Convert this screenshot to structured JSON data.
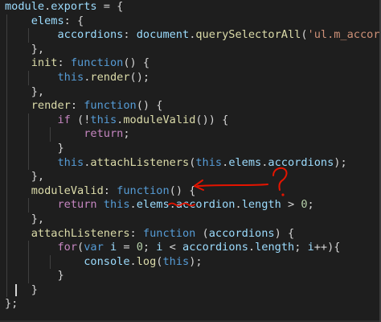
{
  "editor": {
    "annotation_color": "#e51400",
    "lines": [
      {
        "indent": 0,
        "tokens": [
          {
            "t": "module",
            "c": "var"
          },
          {
            "t": ".",
            "c": "pun"
          },
          {
            "t": "exports",
            "c": "var"
          },
          {
            "t": " = {",
            "c": "pun"
          }
        ]
      },
      {
        "indent": 1,
        "tokens": [
          {
            "t": "elems",
            "c": "var"
          },
          {
            "t": ": {",
            "c": "pun"
          }
        ]
      },
      {
        "indent": 2,
        "tokens": [
          {
            "t": "accordions",
            "c": "var"
          },
          {
            "t": ": ",
            "c": "pun"
          },
          {
            "t": "document",
            "c": "var"
          },
          {
            "t": ".",
            "c": "pun"
          },
          {
            "t": "querySelectorAll",
            "c": "fn"
          },
          {
            "t": "(",
            "c": "pun"
          },
          {
            "t": "'ul.m_accordion'",
            "c": "str"
          },
          {
            "t": ")",
            "c": "pun"
          }
        ]
      },
      {
        "indent": 1,
        "tokens": [
          {
            "t": "},",
            "c": "pun"
          }
        ]
      },
      {
        "indent": 1,
        "tokens": [
          {
            "t": "init",
            "c": "fn"
          },
          {
            "t": ": ",
            "c": "pun"
          },
          {
            "t": "function",
            "c": "kw"
          },
          {
            "t": "() {",
            "c": "pun"
          }
        ]
      },
      {
        "indent": 2,
        "tokens": [
          {
            "t": "this",
            "c": "kw"
          },
          {
            "t": ".",
            "c": "pun"
          },
          {
            "t": "render",
            "c": "fn"
          },
          {
            "t": "();",
            "c": "pun"
          }
        ]
      },
      {
        "indent": 1,
        "tokens": [
          {
            "t": "},",
            "c": "pun"
          }
        ]
      },
      {
        "indent": 1,
        "tokens": [
          {
            "t": "render",
            "c": "fn"
          },
          {
            "t": ": ",
            "c": "pun"
          },
          {
            "t": "function",
            "c": "kw"
          },
          {
            "t": "() {",
            "c": "pun"
          }
        ]
      },
      {
        "indent": 2,
        "tokens": [
          {
            "t": "if",
            "c": "ctl"
          },
          {
            "t": " (!",
            "c": "pun"
          },
          {
            "t": "this",
            "c": "kw"
          },
          {
            "t": ".",
            "c": "pun"
          },
          {
            "t": "moduleValid",
            "c": "fn"
          },
          {
            "t": "()) {",
            "c": "pun"
          }
        ]
      },
      {
        "indent": 3,
        "tokens": [
          {
            "t": "return",
            "c": "ctl"
          },
          {
            "t": ";",
            "c": "pun"
          }
        ]
      },
      {
        "indent": 2,
        "tokens": [
          {
            "t": "}",
            "c": "pun"
          }
        ]
      },
      {
        "indent": 2,
        "tokens": [
          {
            "t": "this",
            "c": "kw"
          },
          {
            "t": ".",
            "c": "pun"
          },
          {
            "t": "attachListeners",
            "c": "fn"
          },
          {
            "t": "(",
            "c": "pun"
          },
          {
            "t": "this",
            "c": "kw"
          },
          {
            "t": ".",
            "c": "pun"
          },
          {
            "t": "elems",
            "c": "var"
          },
          {
            "t": ".",
            "c": "pun"
          },
          {
            "t": "accordions",
            "c": "var"
          },
          {
            "t": ");",
            "c": "pun"
          }
        ]
      },
      {
        "indent": 1,
        "tokens": [
          {
            "t": "},",
            "c": "pun"
          }
        ]
      },
      {
        "indent": 1,
        "tokens": [
          {
            "t": "moduleValid",
            "c": "fn"
          },
          {
            "t": ": ",
            "c": "pun"
          },
          {
            "t": "function",
            "c": "kw"
          },
          {
            "t": "() {",
            "c": "pun"
          }
        ]
      },
      {
        "indent": 2,
        "tokens": [
          {
            "t": "return",
            "c": "ctl"
          },
          {
            "t": " ",
            "c": "pun"
          },
          {
            "t": "this",
            "c": "kw"
          },
          {
            "t": ".",
            "c": "pun"
          },
          {
            "t": "elems",
            "c": "var"
          },
          {
            "t": ".",
            "c": "pun"
          },
          {
            "t": "accordion",
            "c": "var"
          },
          {
            "t": ".",
            "c": "pun"
          },
          {
            "t": "length",
            "c": "var"
          },
          {
            "t": " > ",
            "c": "pun"
          },
          {
            "t": "0",
            "c": "num"
          },
          {
            "t": ";",
            "c": "pun"
          }
        ]
      },
      {
        "indent": 1,
        "tokens": [
          {
            "t": "},",
            "c": "pun"
          }
        ]
      },
      {
        "indent": 1,
        "tokens": [
          {
            "t": "attachListeners",
            "c": "fn"
          },
          {
            "t": ": ",
            "c": "pun"
          },
          {
            "t": "function",
            "c": "kw"
          },
          {
            "t": " (",
            "c": "pun"
          },
          {
            "t": "accordions",
            "c": "var"
          },
          {
            "t": ") {",
            "c": "pun"
          }
        ]
      },
      {
        "indent": 2,
        "tokens": [
          {
            "t": "for",
            "c": "ctl"
          },
          {
            "t": "(",
            "c": "pun"
          },
          {
            "t": "var",
            "c": "kw"
          },
          {
            "t": " ",
            "c": "pun"
          },
          {
            "t": "i",
            "c": "var"
          },
          {
            "t": " = ",
            "c": "pun"
          },
          {
            "t": "0",
            "c": "num"
          },
          {
            "t": "; ",
            "c": "pun"
          },
          {
            "t": "i",
            "c": "var"
          },
          {
            "t": " < ",
            "c": "pun"
          },
          {
            "t": "accordions",
            "c": "var"
          },
          {
            "t": ".",
            "c": "pun"
          },
          {
            "t": "length",
            "c": "var"
          },
          {
            "t": "; ",
            "c": "pun"
          },
          {
            "t": "i",
            "c": "var"
          },
          {
            "t": "++){",
            "c": "pun"
          }
        ]
      },
      {
        "indent": 3,
        "tokens": [
          {
            "t": "console",
            "c": "var"
          },
          {
            "t": ".",
            "c": "pun"
          },
          {
            "t": "log",
            "c": "fn"
          },
          {
            "t": "(",
            "c": "pun"
          },
          {
            "t": "this",
            "c": "kw"
          },
          {
            "t": ");",
            "c": "pun"
          }
        ]
      },
      {
        "indent": 2,
        "tokens": [
          {
            "t": "}",
            "c": "pun"
          }
        ]
      },
      {
        "indent": 1,
        "tokens": [
          {
            "t": "}",
            "c": "pun"
          }
        ]
      },
      {
        "indent": 0,
        "tokens": [
          {
            "t": "};",
            "c": "pun"
          }
        ]
      }
    ]
  }
}
